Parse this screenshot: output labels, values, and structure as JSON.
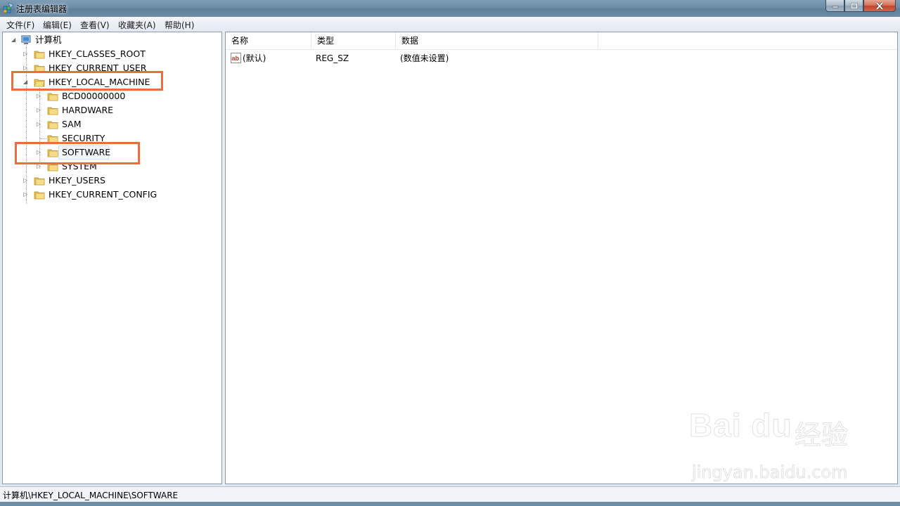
{
  "window": {
    "title": "注册表编辑器",
    "app_icon": "registry-editor-icon"
  },
  "menu": [
    "文件(F)",
    "编辑(E)",
    "查看(V)",
    "收藏夹(A)",
    "帮助(H)"
  ],
  "tree": {
    "root": "计算机",
    "hives": [
      {
        "label": "HKEY_CLASSES_ROOT"
      },
      {
        "label": "HKEY_CURRENT_USER"
      },
      {
        "label": "HKEY_LOCAL_MACHINE",
        "expanded": true,
        "highlighted": true,
        "children": [
          {
            "label": "BCD00000000"
          },
          {
            "label": "HARDWARE"
          },
          {
            "label": "SAM"
          },
          {
            "label": "SECURITY"
          },
          {
            "label": "SOFTWARE",
            "selected": true,
            "highlighted": true
          },
          {
            "label": "SYSTEM"
          }
        ]
      },
      {
        "label": "HKEY_USERS"
      },
      {
        "label": "HKEY_CURRENT_CONFIG"
      }
    ]
  },
  "list": {
    "columns": [
      "名称",
      "类型",
      "数据"
    ],
    "rows": [
      {
        "name": "(默认)",
        "type": "REG_SZ",
        "data": "(数值未设置)",
        "icon": "string-value-icon"
      }
    ]
  },
  "status_path": "计算机\\HKEY_LOCAL_MACHINE\\SOFTWARE",
  "watermark": {
    "logo": "Bai du",
    "cn": "经验",
    "url": "jingyan.baidu.com"
  },
  "colors": {
    "highlight_box": "#ec6e3f",
    "title_bar": "#6c8ba5"
  }
}
